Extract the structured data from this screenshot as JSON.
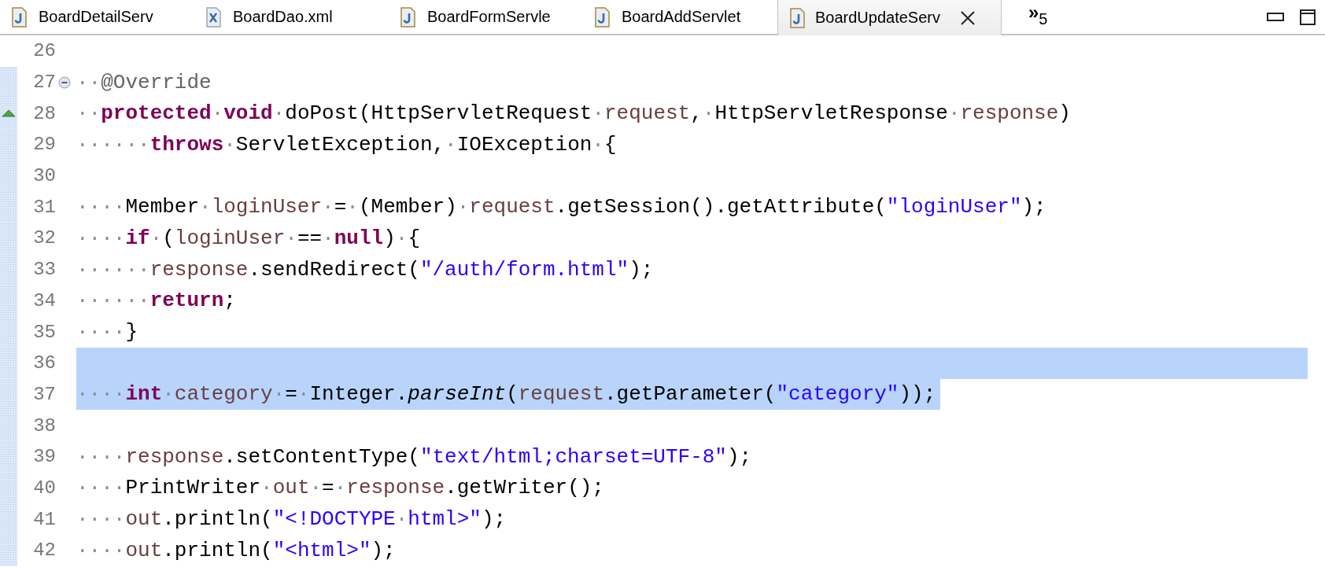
{
  "tabs": [
    {
      "label": "BoardDetailServ",
      "kind": "java",
      "selected": false
    },
    {
      "label": "BoardDao.xml",
      "kind": "xml",
      "selected": false
    },
    {
      "label": "BoardFormServle",
      "kind": "java",
      "selected": false
    },
    {
      "label": "BoardAddServlet",
      "kind": "java",
      "selected": false
    },
    {
      "label": "BoardUpdateServ",
      "kind": "java",
      "selected": true
    }
  ],
  "overflow": {
    "chevron": "»",
    "count": "5"
  },
  "lines": [
    {
      "number": "26",
      "changed": false
    },
    {
      "number": "27",
      "changed": true,
      "foldable": true,
      "tokens": [
        {
          "kind": "ws",
          "text": "··"
        },
        {
          "kind": "ann",
          "text": "@Override"
        }
      ]
    },
    {
      "number": "28",
      "changed": true,
      "override": true,
      "tokens": [
        {
          "kind": "ws",
          "text": "··"
        },
        {
          "kind": "kw",
          "text": "protected"
        },
        {
          "kind": "ws",
          "text": "·"
        },
        {
          "kind": "kw",
          "text": "void"
        },
        {
          "kind": "ws",
          "text": "·"
        },
        {
          "kind": "plain",
          "text": "doPost(HttpServletRequest"
        },
        {
          "kind": "ws",
          "text": "·"
        },
        {
          "kind": "var",
          "text": "request"
        },
        {
          "kind": "plain",
          "text": ","
        },
        {
          "kind": "ws",
          "text": "·"
        },
        {
          "kind": "plain",
          "text": "HttpServletResponse"
        },
        {
          "kind": "ws",
          "text": "·"
        },
        {
          "kind": "var",
          "text": "response"
        },
        {
          "kind": "plain",
          "text": ")"
        }
      ]
    },
    {
      "number": "29",
      "changed": true,
      "tokens": [
        {
          "kind": "ws",
          "text": "······"
        },
        {
          "kind": "kw",
          "text": "throws"
        },
        {
          "kind": "ws",
          "text": "·"
        },
        {
          "kind": "plain",
          "text": "ServletException,"
        },
        {
          "kind": "ws",
          "text": "·"
        },
        {
          "kind": "plain",
          "text": "IOException"
        },
        {
          "kind": "ws",
          "text": "·"
        },
        {
          "kind": "plain",
          "text": "{"
        }
      ]
    },
    {
      "number": "30",
      "changed": true
    },
    {
      "number": "31",
      "changed": true,
      "tokens": [
        {
          "kind": "ws",
          "text": "····"
        },
        {
          "kind": "plain",
          "text": "Member"
        },
        {
          "kind": "ws",
          "text": "·"
        },
        {
          "kind": "var",
          "text": "loginUser"
        },
        {
          "kind": "ws",
          "text": "·"
        },
        {
          "kind": "plain",
          "text": "="
        },
        {
          "kind": "ws",
          "text": "·"
        },
        {
          "kind": "plain",
          "text": "(Member)"
        },
        {
          "kind": "ws",
          "text": "·"
        },
        {
          "kind": "var",
          "text": "request"
        },
        {
          "kind": "plain",
          "text": ".getSession().getAttribute("
        },
        {
          "kind": "str",
          "text": "\"loginUser\""
        },
        {
          "kind": "plain",
          "text": ");"
        }
      ]
    },
    {
      "number": "32",
      "changed": true,
      "tokens": [
        {
          "kind": "ws",
          "text": "····"
        },
        {
          "kind": "kw",
          "text": "if"
        },
        {
          "kind": "ws",
          "text": "·"
        },
        {
          "kind": "plain",
          "text": "("
        },
        {
          "kind": "var",
          "text": "loginUser"
        },
        {
          "kind": "ws",
          "text": "·"
        },
        {
          "kind": "plain",
          "text": "=="
        },
        {
          "kind": "ws",
          "text": "·"
        },
        {
          "kind": "kw",
          "text": "null"
        },
        {
          "kind": "plain",
          "text": ")"
        },
        {
          "kind": "ws",
          "text": "·"
        },
        {
          "kind": "plain",
          "text": "{"
        }
      ]
    },
    {
      "number": "33",
      "changed": true,
      "tokens": [
        {
          "kind": "ws",
          "text": "······"
        },
        {
          "kind": "var",
          "text": "response"
        },
        {
          "kind": "plain",
          "text": ".sendRedirect("
        },
        {
          "kind": "str",
          "text": "\"/auth/form.html\""
        },
        {
          "kind": "plain",
          "text": ");"
        }
      ]
    },
    {
      "number": "34",
      "changed": true,
      "tokens": [
        {
          "kind": "ws",
          "text": "······"
        },
        {
          "kind": "kw",
          "text": "return"
        },
        {
          "kind": "plain",
          "text": ";"
        }
      ]
    },
    {
      "number": "35",
      "changed": true,
      "tokens": [
        {
          "kind": "ws",
          "text": "····"
        },
        {
          "kind": "plain",
          "text": "}"
        }
      ]
    },
    {
      "number": "36",
      "changed": true,
      "selected": true
    },
    {
      "number": "37",
      "changed": true,
      "selected": true,
      "tokens": [
        {
          "kind": "ws",
          "text": "····"
        },
        {
          "kind": "kw",
          "text": "int"
        },
        {
          "kind": "ws",
          "text": "·"
        },
        {
          "kind": "var",
          "text": "category"
        },
        {
          "kind": "ws",
          "text": "·"
        },
        {
          "kind": "plain",
          "text": "="
        },
        {
          "kind": "ws",
          "text": "·"
        },
        {
          "kind": "plain",
          "text": "Integer."
        },
        {
          "kind": "static",
          "text": "parseInt"
        },
        {
          "kind": "plain",
          "text": "("
        },
        {
          "kind": "var",
          "text": "request"
        },
        {
          "kind": "plain",
          "text": ".getParameter("
        },
        {
          "kind": "str",
          "text": "\"category\""
        },
        {
          "kind": "plain",
          "text": "));"
        }
      ]
    },
    {
      "number": "38",
      "changed": true
    },
    {
      "number": "39",
      "changed": true,
      "tokens": [
        {
          "kind": "ws",
          "text": "····"
        },
        {
          "kind": "var",
          "text": "response"
        },
        {
          "kind": "plain",
          "text": ".setContentType("
        },
        {
          "kind": "str",
          "text": "\"text/html;charset=UTF-8\""
        },
        {
          "kind": "plain",
          "text": ");"
        }
      ]
    },
    {
      "number": "40",
      "changed": true,
      "tokens": [
        {
          "kind": "ws",
          "text": "····"
        },
        {
          "kind": "plain",
          "text": "PrintWriter"
        },
        {
          "kind": "ws",
          "text": "·"
        },
        {
          "kind": "var",
          "text": "out"
        },
        {
          "kind": "ws",
          "text": "·"
        },
        {
          "kind": "plain",
          "text": "="
        },
        {
          "kind": "ws",
          "text": "·"
        },
        {
          "kind": "var",
          "text": "response"
        },
        {
          "kind": "plain",
          "text": ".getWriter();"
        }
      ]
    },
    {
      "number": "41",
      "changed": true,
      "tokens": [
        {
          "kind": "ws",
          "text": "····"
        },
        {
          "kind": "var",
          "text": "out"
        },
        {
          "kind": "plain",
          "text": ".println("
        },
        {
          "kind": "str",
          "text": "\"<!DOCTYPE"
        },
        {
          "kind": "ws",
          "text": "·"
        },
        {
          "kind": "str",
          "text": "html>\""
        },
        {
          "kind": "plain",
          "text": ");"
        }
      ]
    },
    {
      "number": "42",
      "changed": true,
      "tokens": [
        {
          "kind": "ws",
          "text": "····"
        },
        {
          "kind": "var",
          "text": "out"
        },
        {
          "kind": "plain",
          "text": ".println("
        },
        {
          "kind": "str",
          "text": "\"<html>\""
        },
        {
          "kind": "plain",
          "text": ");"
        }
      ]
    }
  ]
}
